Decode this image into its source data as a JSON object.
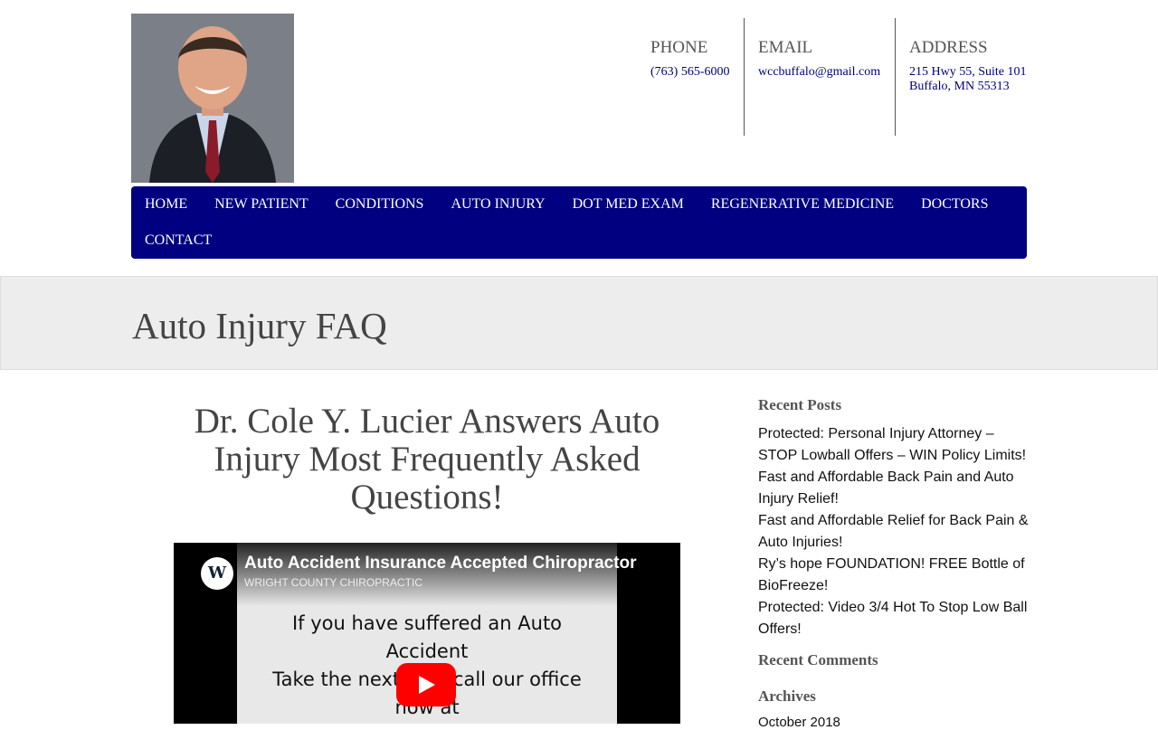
{
  "contact": {
    "phone": {
      "label": "PHONE",
      "value": "(763) 565-6000"
    },
    "email": {
      "label": "EMAIL",
      "value": "wccbuffalo@gmail.com"
    },
    "address": {
      "label": "ADDRESS",
      "value": "215 Hwy 55, Suite 101\nBuffalo, MN 55313"
    }
  },
  "nav": {
    "items": [
      "HOME",
      "NEW PATIENT",
      "CONDITIONS",
      "AUTO INJURY",
      "DOT MED EXAM",
      "REGENERATIVE MEDICINE",
      "DOCTORS",
      "CONTACT"
    ]
  },
  "page": {
    "title": "Auto Injury FAQ"
  },
  "article": {
    "heading": "Dr. Cole Y. Lucier Answers Auto Injury Most Frequently Asked Questions!",
    "video": {
      "logo_text": "W",
      "title": "Auto Accident Insurance Accepted Chiropractor",
      "channel": "WRIGHT COUNTY CHIROPRACTIC",
      "body_lines": [
        "If you have suffered an Auto",
        "Accident",
        "Take the next step call our office",
        "now at"
      ]
    }
  },
  "sidebar": {
    "recent_posts_title": "Recent Posts",
    "recent_posts": [
      "Protected: Personal Injury Attorney – STOP Lowball Offers – WIN Policy Limits!",
      "Fast and Affordable Back Pain and Auto Injury Relief!",
      "Fast and Affordable Relief for Back Pain & Auto Injuries!",
      "Ry’s hope FOUNDATION! FREE Bottle of BioFreeze!",
      "Protected: Video 3/4 Hot To Stop Low Ball Offers!"
    ],
    "recent_comments_title": "Recent Comments",
    "archives_title": "Archives",
    "archives": [
      "October 2018"
    ]
  },
  "colors": {
    "nav_bg": "#000080",
    "link": "#00007a",
    "banner_bg": "#ededed"
  }
}
